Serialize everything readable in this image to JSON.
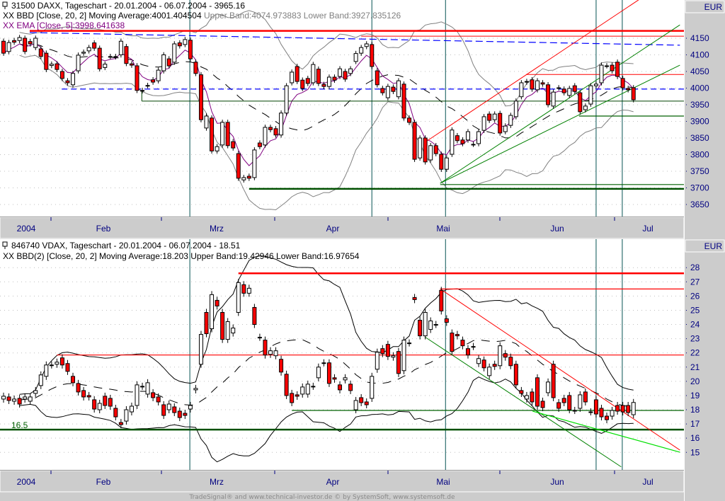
{
  "colors": {
    "up": "#ffffff",
    "down": "#ff0000",
    "axis_text": "#000080",
    "grid": "#c0c0c0",
    "upper_lower_band_top": "#808080",
    "ema": "#800080",
    "vline": "#2f6f6f"
  },
  "top_panel": {
    "title_icon": "chart-window-icon",
    "title": "31500  DAXX, Tageschart - 20.01.2004 - 06.07.2004 - 3965.16",
    "bbd_label": "XX BBD [Close, 20, 2] Moving Average:4001.404504",
    "bbd_bands": " Upper Band:4074.973883 Lower Band:3927.835126",
    "ema_label": "XX EMA [Close, 5]:3998.641638",
    "currency": "EUR"
  },
  "bottom_panel": {
    "title_icon": "chart-window-icon",
    "title": "846740  VDAX, Tageschart - 20.01.2004 - 06.07.2004 - 18.51",
    "bbd_label": "XX BBD(2) [Close, 20, 2] Moving Average:18.203 Upper Band:19.42946 Lower Band:16.97654",
    "currency": "EUR",
    "level_label": "16.5"
  },
  "x_axis_labels": [
    "2004",
    "Feb",
    "Mrz",
    "Apr",
    "Mai",
    "Jun",
    "Jul"
  ],
  "footer": "TradeSignal® and www.technical-investor.de © by  SystemSoft, www.systemsoft.de",
  "chart_data": [
    {
      "type": "candlestick",
      "title": "31500 DAXX, Tageschart",
      "ylabel": "EUR",
      "ylim": [
        3625,
        4190
      ],
      "yticks": [
        3650,
        3700,
        3750,
        3800,
        3850,
        3900,
        3950,
        4000,
        4050,
        4100,
        4150
      ],
      "indicators": [
        "BBD [Close, 20, 2]",
        "EMA [Close, 5]"
      ],
      "open": [
        4141,
        4110,
        4143,
        4143,
        4150,
        4140,
        4122,
        4118,
        4105,
        4068,
        4073,
        4050,
        4022,
        4010,
        4052,
        4105,
        4112,
        4136,
        4120,
        4062,
        4095,
        4095,
        4100,
        4125,
        4073,
        4067,
        3993,
        4007,
        4025,
        4022,
        4052,
        4088,
        4078,
        4136,
        4131,
        4144,
        4078,
        4040,
        3880,
        3910,
        3811,
        3829,
        3897,
        3839,
        3803,
        3724,
        3735,
        3731,
        3835,
        3829,
        3882,
        3878,
        3859,
        3925,
        4016,
        4065,
        4024,
        4029,
        4016,
        4057,
        4011,
        4005,
        4033,
        4035,
        4050,
        4044,
        4080,
        4105,
        4125,
        4131,
        4052,
        3999,
        3971,
        4003,
        3974,
        4012,
        3910,
        3897,
        3790,
        3850,
        3784,
        3827,
        3801,
        3756,
        3801,
        3857,
        3844,
        3844,
        3831,
        3833,
        3873,
        3922,
        3905,
        3924,
        3869,
        3888,
        3914,
        3974,
        4020,
        4025,
        3995,
        4016,
        4010,
        3946,
        4001,
        3997,
        3978,
        4007,
        3986,
        3935,
        3952,
        4007,
        4016,
        4067,
        4069,
        4078,
        4029,
        3999,
        4001
      ],
      "close": [
        4105,
        4137,
        4138,
        4152,
        4110,
        4133,
        4150,
        4095,
        4056,
        4072,
        4056,
        4029,
        4016,
        4044,
        4099,
        4108,
        4122,
        4120,
        4058,
        4072,
        4095,
        4094,
        4141,
        4074,
        4069,
        3993,
        3992,
        4008,
        4018,
        4054,
        4100,
        4067,
        4133,
        4127,
        4146,
        4088,
        4044,
        3905,
        3916,
        3811,
        3824,
        3897,
        3827,
        3820,
        3729,
        3731,
        3729,
        3814,
        3824,
        3882,
        3875,
        3859,
        3925,
        4007,
        4048,
        4020,
        3999,
        4014,
        4071,
        4014,
        4005,
        4033,
        4024,
        4058,
        4027,
        4058,
        4104,
        4122,
        4133,
        4065,
        4010,
        3986,
        4005,
        3990,
        4022,
        3910,
        3897,
        3786,
        3850,
        3778,
        3827,
        3803,
        3756,
        3790,
        3874,
        3842,
        3833,
        3869,
        3831,
        3869,
        3914,
        3903,
        3922,
        3865,
        3886,
        3918,
        3961,
        4016,
        4018,
        3997,
        4022,
        4012,
        3950,
        3988,
        4001,
        3986,
        3999,
        3990,
        3929,
        3946,
        4007,
        4012,
        4069,
        4067,
        4052,
        4035,
        4001,
        3995,
        3965
      ],
      "wick": 8,
      "hlines": [
        {
          "value": 4172,
          "from_bar": 4.9,
          "color": "#ff0000",
          "width": 2.5
        },
        {
          "value": 4156,
          "from_bar": 67,
          "color": "#ff0000",
          "width": 1
        },
        {
          "value": 4041,
          "from_bar": 97.9,
          "color": "#ff0000",
          "width": 1
        },
        {
          "value": 3997,
          "from_bar": 10.9,
          "color": "#0000ff",
          "width": 1.2,
          "dash": "8,5"
        },
        {
          "value": 3961,
          "from_bar": 25.9,
          "color": "#004000",
          "width": 1
        },
        {
          "value": 3916,
          "from_bar": 107.8,
          "color": "#006000",
          "width": 1.2
        },
        {
          "value": 3710,
          "from_bar": 81.8,
          "color": "#006000",
          "width": 1.2
        },
        {
          "value": 3697,
          "from_bar": 46,
          "color": "#005000",
          "width": 2.5
        }
      ],
      "trendlines": [
        {
          "from": [
            4.9,
            4167
          ],
          "to": [
            126.7,
            4129
          ],
          "color": "#0000ff",
          "width": 1.2,
          "dash": "10,5"
        },
        {
          "from": [
            25.9,
            3993
          ],
          "to": [
            25.9,
            3961
          ],
          "color": "#004000",
          "width": 1
        },
        {
          "from": [
            79.3,
            3841
          ],
          "to": [
            126.7,
            4348
          ],
          "color": "#ff0000",
          "width": 1
        },
        {
          "from": [
            81.8,
            3714
          ],
          "to": [
            126.7,
            4190
          ],
          "color": "#008000",
          "width": 1
        },
        {
          "from": [
            81.8,
            3714
          ],
          "to": [
            126.7,
            4069
          ],
          "color": "#008000",
          "width": 1
        }
      ],
      "vlines_bars": [
        34.9,
        69,
        82.8,
        111,
        115.9
      ]
    },
    {
      "type": "candlestick",
      "title": "846740 VDAX, Tageschart",
      "ylabel": "EUR",
      "ylim": [
        14.7,
        28.7
      ],
      "yticks": [
        15,
        16,
        17,
        18,
        19,
        20,
        21,
        22,
        23,
        24,
        25,
        26,
        27,
        28
      ],
      "indicators": [
        "BBD(2) [Close, 20, 2]"
      ],
      "open": [
        18.75,
        18.9,
        18.6,
        18.8,
        18.75,
        18.6,
        19.15,
        19.7,
        20.35,
        21.15,
        21.2,
        21.65,
        21.25,
        20.35,
        19.85,
        19.35,
        19.0,
        18.7,
        18.0,
        18.95,
        18.8,
        18.1,
        17.1,
        17.2,
        17.85,
        18.3,
        19.65,
        19.1,
        19.2,
        18.9,
        18.35,
        18.0,
        18.2,
        17.9,
        17.75,
        18.05,
        19.4,
        21.2,
        24.85,
        23.7,
        25.7,
        24.85,
        22.95,
        23.4,
        24.85,
        26.8,
        26.2,
        25.2,
        23.1,
        22.9,
        21.9,
        21.8,
        21.55,
        20.5,
        19.15,
        19.05,
        19.1,
        19.1,
        19.65,
        20.25,
        21.3,
        21.3,
        20.25,
        19.75,
        20.1,
        19.8,
        18.0,
        18.85,
        18.55,
        18.8,
        20.85,
        22.3,
        22.6,
        21.7,
        22.1,
        20.75,
        22.7,
        25.9,
        24.3,
        23.2,
        23.65,
        24.0,
        26.4,
        24.4,
        23.4,
        23.3,
        22.9,
        22.3,
        22.45,
        21.25,
        21.5,
        20.4,
        21.2,
        21.1,
        21.95,
        21.7,
        21.2,
        19.35,
        18.75,
        19.25,
        20.25,
        18.6,
        19.2,
        21.2,
        18.5,
        18.8,
        19.0,
        17.95,
        18.1,
        19.25,
        17.85,
        18.7,
        18.1,
        17.55,
        17.55,
        18.3,
        18.3,
        18.3,
        17.65
      ],
      "close": [
        18.95,
        18.65,
        18.75,
        18.4,
        18.9,
        18.9,
        19.35,
        20.45,
        21.15,
        21.15,
        21.35,
        21.15,
        20.7,
        19.9,
        19.25,
        18.9,
        18.9,
        18.05,
        18.45,
        18.3,
        18.25,
        17.5,
        16.95,
        18.0,
        18.25,
        19.75,
        19.65,
        19.9,
        18.85,
        18.55,
        17.6,
        18.4,
        17.8,
        17.45,
        17.6,
        18.3,
        19.5,
        23.3,
        23.35,
        26.1,
        25.3,
        22.95,
        24.2,
        23.75,
        26.95,
        26.2,
        26.55,
        24.0,
        23.1,
        21.85,
        22.15,
        22.15,
        20.65,
        19.0,
        18.5,
        18.95,
        19.6,
        19.8,
        19.65,
        21.0,
        21.3,
        19.85,
        20.15,
        19.4,
        20.25,
        19.35,
        18.65,
        18.5,
        18.35,
        20.35,
        22.05,
        21.95,
        21.75,
        21.8,
        20.55,
        22.9,
        22.7,
        25.75,
        23.2,
        24.85,
        24.25,
        24.0,
        24.95,
        24.15,
        22.1,
        23.2,
        22.5,
        21.85,
        22.45,
        21.6,
        20.95,
        21.0,
        21.05,
        22.5,
        21.7,
        21.1,
        19.75,
        19.15,
        19.0,
        18.55,
        18.25,
        18.15,
        19.95,
        18.85,
        18.1,
        18.5,
        18.0,
        17.95,
        19.05,
        18.55,
        17.85,
        17.7,
        17.5,
        17.3,
        17.95,
        17.9,
        17.85,
        17.8,
        18.51
      ],
      "wick": 0.25,
      "hlines": [
        {
          "value": 27.6,
          "from_bar": 44,
          "color": "#ff0000",
          "width": 2.5
        },
        {
          "value": 26.5,
          "from_bar": 81.8,
          "color": "#ff0000",
          "width": 1.2
        },
        {
          "value": 21.85,
          "from_bar": 10,
          "color": "#ff0000",
          "width": 1.2
        },
        {
          "value": 17.95,
          "from_bar": 54,
          "color": "#006000",
          "width": 1.2
        },
        {
          "value": 16.6,
          "from_bar": -1,
          "color": "#005000",
          "width": 2.5
        }
      ],
      "trendlines": [
        {
          "from": [
            81.8,
            26.5
          ],
          "to": [
            126.7,
            15.16
          ],
          "color": "#ff0000",
          "width": 1
        },
        {
          "from": [
            78.9,
            23.13
          ],
          "to": [
            115.7,
            13.98
          ],
          "color": "#008000",
          "width": 1
        },
        {
          "from": [
            99.1,
            17.9
          ],
          "to": [
            126.7,
            15.01
          ],
          "color": "#00e000",
          "width": 1.2
        }
      ],
      "vlines_bars": [
        34.9,
        82.8,
        111,
        115.9
      ]
    }
  ]
}
